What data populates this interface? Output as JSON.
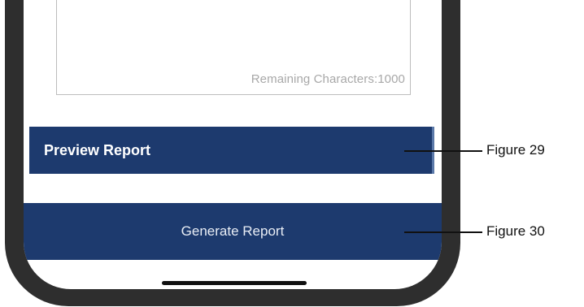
{
  "textarea": {
    "remaining_label": "Remaining Characters:1000"
  },
  "buttons": {
    "preview_label": "Preview Report",
    "generate_label": "Generate Report"
  },
  "callouts": [
    {
      "label": "Figure 29"
    },
    {
      "label": "Figure 30"
    }
  ],
  "colors": {
    "button_bg": "#1d3a6e",
    "phone_frame": "#2e2e2e"
  }
}
